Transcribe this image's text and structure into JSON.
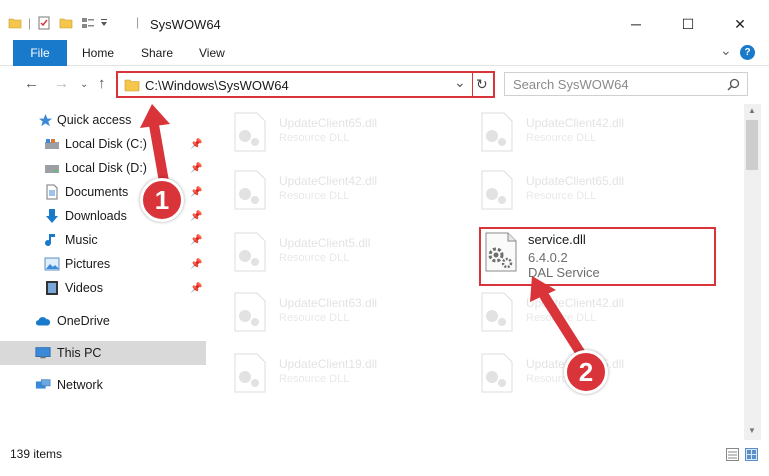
{
  "window": {
    "title": "SysWOW64",
    "minimize_glyph": "─",
    "maximize_glyph": "☐",
    "close_glyph": "✕"
  },
  "ribbon": {
    "tabs": [
      "File",
      "Home",
      "Share",
      "View"
    ],
    "collapse_glyph": "⌄",
    "help_glyph": "?"
  },
  "address": {
    "path": "C:\\Windows\\SysWOW64",
    "dropdown_glyph": "⌄",
    "refresh_glyph": "↻"
  },
  "search": {
    "placeholder": "Search SysWOW64"
  },
  "sidebar": {
    "items": [
      {
        "label": "Quick access",
        "icon": "star-icon"
      },
      {
        "label": "Local Disk (C:)",
        "icon": "drive-icon",
        "pinned": true
      },
      {
        "label": "Local Disk (D:)",
        "icon": "drive-icon",
        "pinned": true
      },
      {
        "label": "Documents",
        "icon": "documents-icon",
        "pinned": true
      },
      {
        "label": "Downloads",
        "icon": "download-icon",
        "pinned": true
      },
      {
        "label": "Music",
        "icon": "music-icon",
        "pinned": true
      },
      {
        "label": "Pictures",
        "icon": "pictures-icon",
        "pinned": true
      },
      {
        "label": "Videos",
        "icon": "videos-icon",
        "pinned": true
      },
      {
        "label": "OneDrive",
        "icon": "cloud-icon"
      },
      {
        "label": "This PC",
        "icon": "computer-icon",
        "selected": true
      },
      {
        "label": "Network",
        "icon": "network-icon"
      }
    ]
  },
  "files": {
    "left": [
      {
        "name": "UpdateClient65.dll",
        "desc": "Resource DLL"
      },
      {
        "name": "UpdateClient42.dll",
        "desc": "Resource DLL"
      },
      {
        "name": "UpdateClient5.dll",
        "desc": "Resource DLL"
      },
      {
        "name": "UpdateClient63.dll",
        "desc": "Resource DLL"
      },
      {
        "name": "UpdateClient19.dll",
        "desc": "Resource DLL"
      }
    ],
    "right": [
      {
        "name": "UpdateClient42.dll",
        "desc": "Resource DLL"
      },
      {
        "name": "UpdateClient65.dll",
        "desc": "Resource DLL"
      },
      {
        "name": "UpdateClient42.dll",
        "desc": "Resource DLL"
      },
      {
        "name": "UpdateClient65.dll",
        "desc": "Resource DLL"
      }
    ],
    "highlighted": {
      "name": "service.dll",
      "version": "6.4.0.2",
      "desc": "DAL Service"
    }
  },
  "status": {
    "item_count": "139 items"
  },
  "callouts": [
    "1",
    "2"
  ],
  "colors": {
    "accent": "#1979ca",
    "highlight": "#d9343a",
    "folder": "#f4c64c"
  }
}
